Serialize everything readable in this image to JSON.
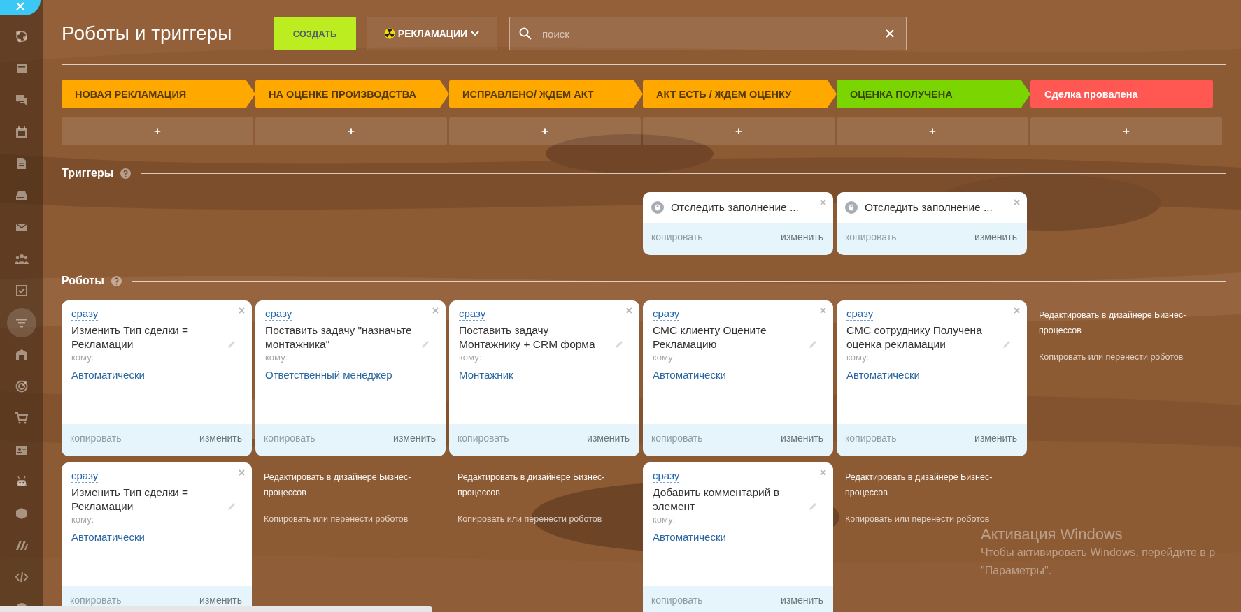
{
  "sidebar": {
    "items": [
      {
        "selected": false
      },
      {
        "selected": false
      },
      {
        "selected": false
      },
      {
        "selected": false
      },
      {
        "selected": false
      },
      {
        "selected": false
      },
      {
        "selected": false
      },
      {
        "selected": false
      },
      {
        "selected": false
      },
      {
        "selected": true
      },
      {
        "selected": false
      },
      {
        "selected": false
      },
      {
        "selected": false
      },
      {
        "selected": false
      },
      {
        "selected": false
      },
      {
        "selected": false
      },
      {
        "selected": false
      },
      {
        "selected": false
      },
      {
        "selected": false
      }
    ]
  },
  "page": {
    "title": "Роботы и триггеры"
  },
  "toolbar": {
    "create_button": "СОЗДАТЬ",
    "category": "РЕКЛАМАЦИИ",
    "search": {
      "placeholder": "поиск"
    }
  },
  "sections": {
    "triggers": "Триггеры",
    "robots": "Роботы"
  },
  "columns": [
    {
      "stage": {
        "label": "НОВАЯ РЕКЛАМАЦИЯ",
        "kind": "arrow",
        "color": "#ffa800"
      },
      "add": "+",
      "robots": [
        {
          "delay": "сразу",
          "title": "Изменить Тип сделки = Рекламации",
          "to_label": "кому:",
          "responsible": "Автоматически",
          "copy": "копировать",
          "edit": "изменить"
        },
        {
          "delay": "сразу",
          "title": "Изменить Тип сделки = Рекламации",
          "to_label": "кому:",
          "responsible": "Автоматически",
          "copy": "копировать",
          "edit": "изменить"
        }
      ]
    },
    {
      "stage": {
        "label": "НА ОЦЕНКЕ ПРОИЗВОДСТВА",
        "kind": "arrow",
        "color": "#ffa800"
      },
      "add": "+",
      "robots": [
        {
          "delay": "сразу",
          "title": "Поставить задачу \"назначьте монтажника\"",
          "to_label": "кому:",
          "responsible": "Ответственный менеджер",
          "copy": "копировать",
          "edit": "изменить"
        }
      ],
      "links": [
        "Редактировать в дизайнере Бизнес-процессов",
        "Копировать или перенести роботов"
      ]
    },
    {
      "stage": {
        "label": "ИСПРАВЛЕНО/ ЖДЕМ АКТ",
        "kind": "arrow",
        "color": "#ffa800"
      },
      "add": "+",
      "robots": [
        {
          "delay": "сразу",
          "title": "Поставить задачу Монтажнику + CRM форма",
          "to_label": "кому:",
          "responsible": "Монтажник",
          "copy": "копировать",
          "edit": "изменить"
        }
      ],
      "links": [
        "Редактировать в дизайнере Бизнес-процессов",
        "Копировать или перенести роботов"
      ]
    },
    {
      "stage": {
        "label": "АКТ ЕСТЬ / ЖДЕМ ОЦЕНКУ",
        "kind": "arrow",
        "color": "#ffa800"
      },
      "add": "+",
      "triggers": [
        {
          "title": "Отследить заполнение ...",
          "copy": "копировать",
          "edit": "изменить"
        }
      ],
      "robots": [
        {
          "delay": "сразу",
          "title": "СМС клиенту Оцените Рекламацию",
          "to_label": "кому:",
          "responsible": "Автоматически",
          "copy": "копировать",
          "edit": "изменить"
        },
        {
          "delay": "сразу",
          "title": "Добавить комментарий в элемент",
          "to_label": "кому:",
          "responsible": "Автоматически",
          "copy": "копировать",
          "edit": "изменить"
        }
      ]
    },
    {
      "stage": {
        "label": "ОЦЕНКА ПОЛУЧЕНА",
        "kind": "arrow",
        "color": "#7bd500"
      },
      "add": "+",
      "triggers": [
        {
          "title": "Отследить заполнение ...",
          "copy": "копировать",
          "edit": "изменить"
        }
      ],
      "robots": [
        {
          "delay": "сразу",
          "title": "СМС сотруднику Получена оценка рекламации",
          "to_label": "кому:",
          "responsible": "Автоматически",
          "copy": "копировать",
          "edit": "изменить"
        }
      ],
      "links": [
        "Редактировать в дизайнере Бизнес-процессов",
        "Копировать или перенести роботов"
      ]
    },
    {
      "stage": {
        "label": "Сделка провалена",
        "kind": "final",
        "color": "#ff5752"
      },
      "add": "+",
      "links": [
        "Редактировать в дизайнере Бизнес-процессов",
        "Копировать или перенести роботов"
      ]
    }
  ],
  "os_notice": {
    "title": "Активация Windows",
    "lines": [
      "Чтобы активировать Windows, перейдите в р",
      "\"Параметры\"."
    ]
  }
}
